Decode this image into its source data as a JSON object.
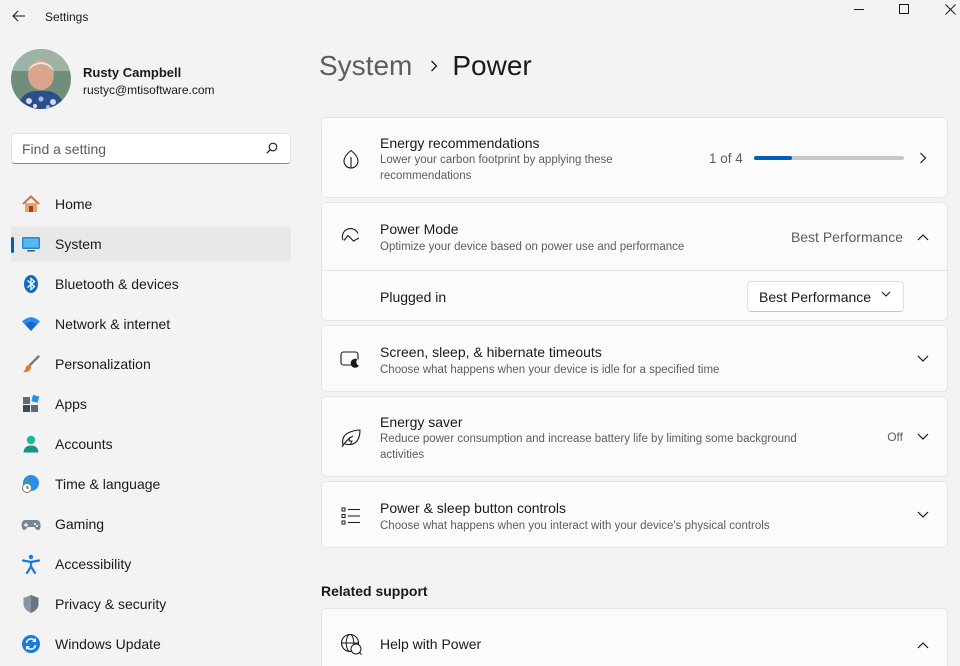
{
  "window": {
    "title": "Settings",
    "back_icon": "back-arrow-icon",
    "controls": [
      "minimize-icon",
      "maximize-icon",
      "close-icon"
    ]
  },
  "profile": {
    "name": "Rusty Campbell",
    "email": "rustyc@mtisoftware.com"
  },
  "search": {
    "placeholder": "Find a setting",
    "value": ""
  },
  "nav": {
    "items": [
      {
        "label": "Home",
        "icon": "home-icon"
      },
      {
        "label": "System",
        "icon": "system-monitor-icon",
        "selected": true
      },
      {
        "label": "Bluetooth & devices",
        "icon": "bluetooth-icon"
      },
      {
        "label": "Network & internet",
        "icon": "wifi-icon"
      },
      {
        "label": "Personalization",
        "icon": "paintbrush-icon"
      },
      {
        "label": "Apps",
        "icon": "apps-icon"
      },
      {
        "label": "Accounts",
        "icon": "accounts-icon"
      },
      {
        "label": "Time & language",
        "icon": "globe-clock-icon"
      },
      {
        "label": "Gaming",
        "icon": "gamepad-icon"
      },
      {
        "label": "Accessibility",
        "icon": "accessibility-icon"
      },
      {
        "label": "Privacy & security",
        "icon": "shield-icon"
      },
      {
        "label": "Windows Update",
        "icon": "update-icon"
      }
    ]
  },
  "header": {
    "parent": "System",
    "current": "Power"
  },
  "cards": {
    "energy_recommendations": {
      "title": "Energy recommendations",
      "desc_line1": "Lower your carbon footprint by applying these",
      "desc_line2": "recommendations",
      "progress_label": "1 of 4",
      "progress_fraction": 0.25,
      "icon": "leaf-icon"
    },
    "power_mode": {
      "title": "Power Mode",
      "desc": "Optimize your device based on power use and performance",
      "value": "Best Performance",
      "icon": "power-mode-gauge-icon",
      "plugged_in_label": "Plugged in",
      "plugged_in_value": "Best Performance"
    },
    "screen_sleep": {
      "title": "Screen, sleep, & hibernate timeouts",
      "desc": "Choose what happens when your device is idle for a specified time",
      "icon": "screen-sleep-icon"
    },
    "energy_saver": {
      "title": "Energy saver",
      "desc_line1": "Reduce power consumption and increase battery life by limiting some background",
      "desc_line2": "activities",
      "value": "Off",
      "icon": "energy-saver-leaf-icon"
    },
    "power_buttons": {
      "title": "Power & sleep button controls",
      "desc": "Choose what happens when you interact with your device's physical controls",
      "icon": "list-settings-icon"
    }
  },
  "related_support": {
    "heading": "Related support",
    "help_title": "Help with Power",
    "icon": "globe-help-icon"
  },
  "colors": {
    "accent": "#005fb8",
    "background": "#f3f3f3",
    "card": "#fbfbfb"
  }
}
